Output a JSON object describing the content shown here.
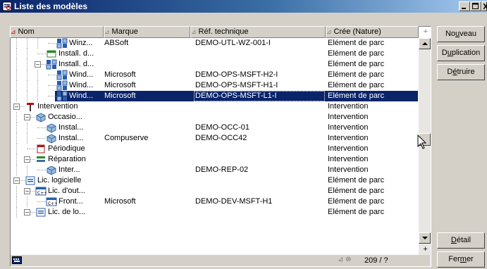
{
  "window": {
    "title": "Liste des modèles"
  },
  "columns": [
    {
      "label": "Nom",
      "active": true
    },
    {
      "label": "Marque",
      "active": false
    },
    {
      "label": "Réf. technique",
      "active": false
    },
    {
      "label": "Crée (Nature)",
      "active": false
    }
  ],
  "column_add_label": "+",
  "rows": [
    {
      "name": "Winz...",
      "brand": "ABSoft",
      "ref": "DEMO-UTL-WZ-001-I",
      "nature": "Elément de parc",
      "icon": "software-model-icon",
      "level": 3,
      "expander": "",
      "selected": false
    },
    {
      "name": "Install. d...",
      "brand": "",
      "ref": "",
      "nature": "Elément de parc",
      "icon": "installation-icon",
      "level": 2,
      "expander": "",
      "selected": false
    },
    {
      "name": "Install. d...",
      "brand": "",
      "ref": "",
      "nature": "Elément de parc",
      "icon": "installation-group-icon",
      "level": 2,
      "expander": "-",
      "selected": false
    },
    {
      "name": "Wind...",
      "brand": "Microsoft",
      "ref": "DEMO-OPS-MSFT-H2-I",
      "nature": "Elément de parc",
      "icon": "windows-install-icon",
      "level": 3,
      "expander": "",
      "selected": false
    },
    {
      "name": "Wind...",
      "brand": "Microsoft",
      "ref": "DEMO-OPS-MSFT-H1-I",
      "nature": "Elément de parc",
      "icon": "windows-install-icon",
      "level": 3,
      "expander": "",
      "selected": false
    },
    {
      "name": "Wind...",
      "brand": "Microsoft",
      "ref": "DEMO-OPS-MSFT-L1-I",
      "nature": "Elément de parc",
      "icon": "windows-install-icon",
      "level": 3,
      "expander": "",
      "selected": true
    },
    {
      "name": "Intervention",
      "brand": "",
      "ref": "",
      "nature": "Intervention",
      "icon": "hammer-icon",
      "level": 0,
      "expander": "-",
      "selected": false
    },
    {
      "name": "Occasio...",
      "brand": "",
      "ref": "",
      "nature": "Intervention",
      "icon": "cube-icon",
      "level": 1,
      "expander": "-",
      "selected": false
    },
    {
      "name": "Instal...",
      "brand": "",
      "ref": "DEMO-OCC-01",
      "nature": "Intervention",
      "icon": "cube-icon",
      "level": 2,
      "expander": "",
      "selected": false
    },
    {
      "name": "Instal...",
      "brand": "Compuserve",
      "ref": "DEMO-OCC42",
      "nature": "Intervention",
      "icon": "cube-icon",
      "level": 2,
      "expander": "",
      "selected": false
    },
    {
      "name": "Périodique",
      "brand": "",
      "ref": "",
      "nature": "Intervention",
      "icon": "calendar-icon",
      "level": 1,
      "expander": "",
      "selected": false
    },
    {
      "name": "Réparation",
      "brand": "",
      "ref": "",
      "nature": "Intervention",
      "icon": "repair-icon",
      "level": 1,
      "expander": "-",
      "selected": false
    },
    {
      "name": "Inter...",
      "brand": "",
      "ref": "DEMO-REP-02",
      "nature": "Intervention",
      "icon": "cube-icon",
      "level": 2,
      "expander": "",
      "selected": false
    },
    {
      "name": "Lic. logicielle",
      "brand": "",
      "ref": "",
      "nature": "Elément de parc",
      "icon": "license-icon",
      "level": 0,
      "expander": "-",
      "selected": false
    },
    {
      "name": "Lic. d'out...",
      "brand": "",
      "ref": "",
      "nature": "Elément de parc",
      "icon": "cpp-license-icon",
      "level": 1,
      "expander": "-",
      "selected": false
    },
    {
      "name": "Front...",
      "brand": "Microsoft",
      "ref": "DEMO-DEV-MSFT-H1",
      "nature": "Elément de parc",
      "icon": "cpp-license-icon",
      "level": 2,
      "expander": "",
      "selected": false
    },
    {
      "name": "Lic. de lo...",
      "brand": "",
      "ref": "",
      "nature": "Elément de parc",
      "icon": "license-icon",
      "level": 1,
      "expander": "-",
      "selected": false
    }
  ],
  "status": {
    "counter": "209 / ?"
  },
  "buttons": {
    "nouveau": {
      "pre": "No",
      "key": "u",
      "post": "veau"
    },
    "duplication": {
      "pre": "D",
      "key": "u",
      "post": "plication"
    },
    "detruire": {
      "pre": "D",
      "key": "é",
      "post": "truire"
    },
    "detail": {
      "pre": "",
      "key": "D",
      "post": "étail"
    },
    "fermer": {
      "pre": "Fer",
      "key": "m",
      "post": "er"
    }
  }
}
